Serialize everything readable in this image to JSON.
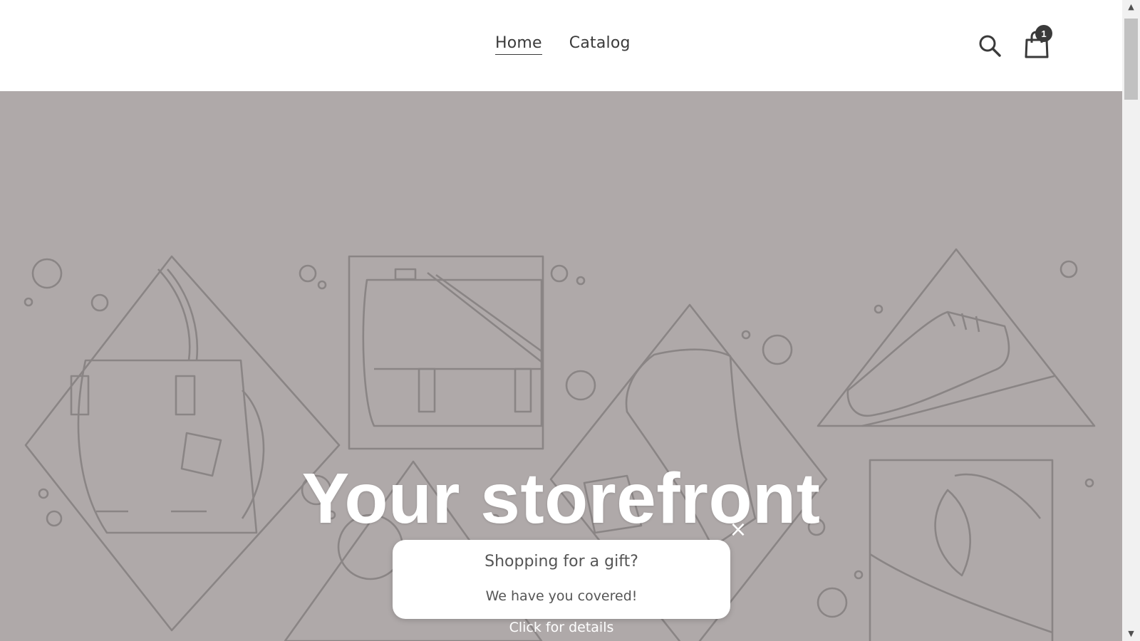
{
  "nav": {
    "items": [
      {
        "label": "Home",
        "active": true
      },
      {
        "label": "Catalog",
        "active": false
      }
    ]
  },
  "header": {
    "search_icon": "search-icon",
    "cart_icon": "shopping-bag-icon",
    "cart_count": "1"
  },
  "hero": {
    "title": "Your storefront",
    "background_color": "#afa9a9"
  },
  "popup": {
    "title": "Shopping for a gift?",
    "subtitle": "We have you covered!",
    "close_label": "×",
    "link_label": "Click for details"
  },
  "colors": {
    "text": "#3a3a3a",
    "hero_bg": "#afa9a9",
    "line_art": "#8a8585"
  }
}
